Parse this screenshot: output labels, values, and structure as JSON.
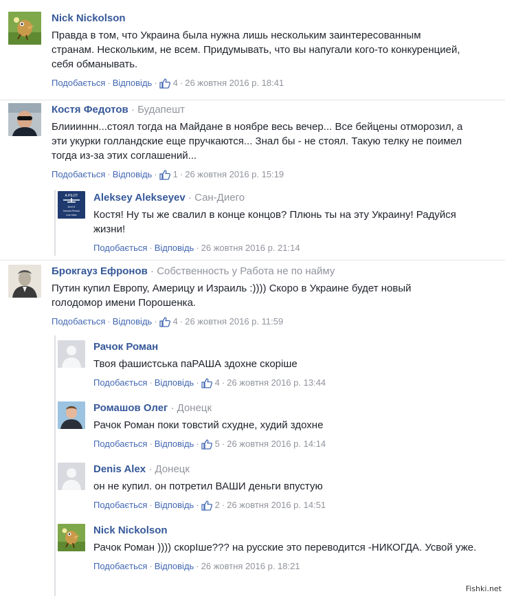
{
  "actions": {
    "like": "Подобається",
    "reply": "Відповідь"
  },
  "comments": [
    {
      "author": "Nick Nickolson",
      "location": "",
      "text": "Правда в том, что Украина была нужна лишь нескольким заинтересованным странам. Нескольким, не всем. Придумывать, что вы напугали кого-то конкуренцией, себя обманывать.",
      "likes": "4",
      "date": "26 жовтня 2016 р. 18:41",
      "avatar": "bird-avatar"
    },
    {
      "author": "Костя Федотов",
      "location": "Будапешт",
      "text": "Блиииннн...стоял тогда на Майдане в ноябре весь вечер... Все бейцены отморозил, а эти укурки голландские еще пручкаются... Знал бы - не стоял. Такую телку не поимел тогда из-за этих соглашений...",
      "likes": "1",
      "date": "26 жовтня 2016 р. 15:19",
      "avatar": "man-sunglasses-avatar"
    },
    {
      "author": "Aleksey Alekseyev",
      "location": "Сан-Диего",
      "text": "Костя! Ну ты же свалил в конце концов? Плюнь ты на эту Украину! Радуйся жизни!",
      "likes": "",
      "date": "26 жовтня 2016 р. 21:14",
      "avatar": "pilot-badge-avatar",
      "avatar_text": [
        "A PILOT",
        "And A",
        "Normal Person",
        "Live Here"
      ]
    },
    {
      "author": "Брокгауз Ефронов",
      "location": "Собственность у Работа не по найму",
      "text": "Путин купил Европу, Америцу и Израиль :)))) Скоро в Украине будет новый голодомор имени Порошенка.",
      "likes": "4",
      "date": "26 жовтня 2016 р. 11:59",
      "avatar": "portrait-engraving-avatar"
    },
    {
      "author": "Рачок Роман",
      "location": "",
      "text": "Твоя фашистська паРАША здохне скоріше",
      "likes": "4",
      "date": "26 жовтня 2016 р. 13:44",
      "avatar": "default-avatar"
    },
    {
      "author": "Ромашов Олег",
      "location": "Донецк",
      "text": "Рачок Роман поки товстий схудне, худий здохне",
      "likes": "5",
      "date": "26 жовтня 2016 р. 14:14",
      "avatar": "man-photo-avatar"
    },
    {
      "author": "Denis Alex",
      "location": "Донецк",
      "text": "он не купил. он потретил ВАШИ деньги впустую",
      "likes": "2",
      "date": "26 жовтня 2016 р. 14:51",
      "avatar": "default-avatar"
    },
    {
      "author": "Nick Nickolson",
      "location": "",
      "text": "Рачок Роман )))) скорІше??? на русские это переводится -НИКОГДА. Усвой уже.",
      "likes": "",
      "date": "26 жовтня 2016 р. 18:21",
      "avatar": "bird-avatar"
    }
  ],
  "watermark": "Fishki.net",
  "colors": {
    "link": "#365899",
    "meta": "#90949c",
    "action": "#4267b2"
  }
}
